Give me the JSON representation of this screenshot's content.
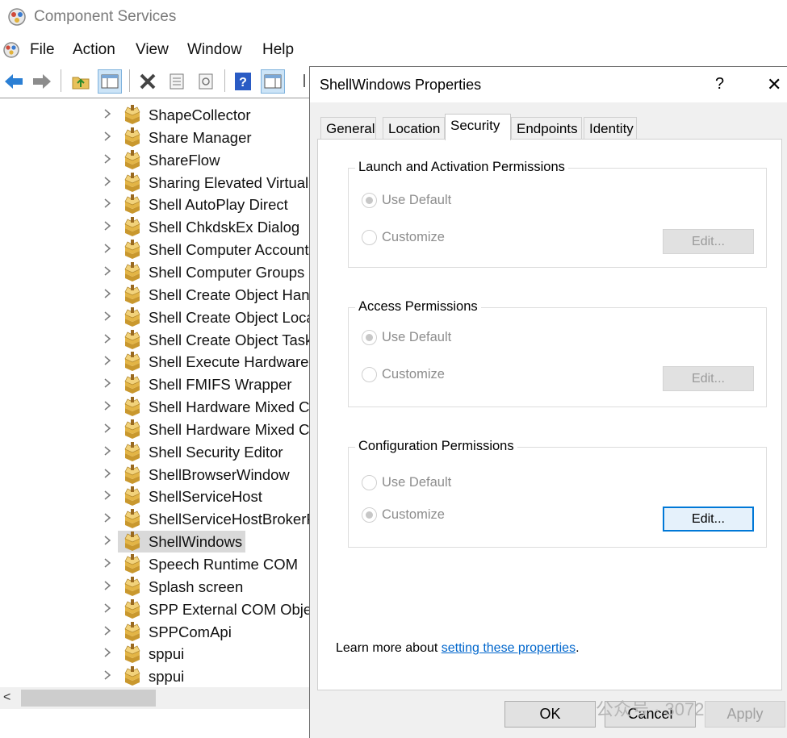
{
  "window": {
    "title": "Component Services",
    "app_icon": "component-services-icon"
  },
  "menu": [
    "File",
    "Action",
    "View",
    "Window",
    "Help"
  ],
  "toolbar": {
    "buttons": [
      "back-arrow-icon",
      "forward-arrow-icon",
      "up-folder-icon",
      "show-hide-tree-icon",
      "delete-icon",
      "properties-icon",
      "refresh-icon",
      "help-icon",
      "show-hide-action-pane-icon",
      "export-icon"
    ]
  },
  "tree": {
    "items": [
      "ShapeCollector",
      "Share Manager",
      "ShareFlow",
      "Sharing Elevated Virtual I",
      "Shell AutoPlay Direct",
      "Shell ChkdskEx Dialog",
      "Shell Computer Account",
      "Shell Computer Groups",
      "Shell Create Object Hand",
      "Shell Create Object Loca",
      "Shell Create Object Task",
      "Shell Execute Hardware E",
      "Shell FMIFS Wrapper",
      "Shell Hardware Mixed Co",
      "Shell Hardware Mixed Co",
      "Shell Security Editor",
      "ShellBrowserWindow",
      "ShellServiceHost",
      "ShellServiceHostBrokerP",
      "ShellWindows",
      "Speech Runtime COM",
      "Splash screen",
      "SPP External COM Objec",
      "SPPComApi",
      "sppui",
      "sppui"
    ],
    "selected": "ShellWindows"
  },
  "scrollbar": {
    "left_arrow": "<"
  },
  "dialog": {
    "title": "ShellWindows Properties",
    "help": "?",
    "close": "✕",
    "tabs": [
      "General",
      "Location",
      "Security",
      "Endpoints",
      "Identity"
    ],
    "active_tab": "Security",
    "groups": [
      {
        "label": "Launch and Activation Permissions",
        "use_default": "Use Default",
        "customize": "Customize",
        "selected": "Use Default",
        "edit": "Edit...",
        "edit_enabled": false
      },
      {
        "label": "Access Permissions",
        "use_default": "Use Default",
        "customize": "Customize",
        "selected": "Use Default",
        "edit": "Edit...",
        "edit_enabled": false
      },
      {
        "label": "Configuration Permissions",
        "use_default": "Use Default",
        "customize": "Customize",
        "selected": "Customize",
        "edit": "Edit...",
        "edit_enabled": true
      }
    ],
    "learn_more_prefix": "Learn more about ",
    "learn_more_link": "setting these properties",
    "learn_more_suffix": ".",
    "buttons": {
      "ok": "OK",
      "cancel": "Cancel",
      "apply": "Apply"
    }
  },
  "watermark": "公众号 · 3072"
}
